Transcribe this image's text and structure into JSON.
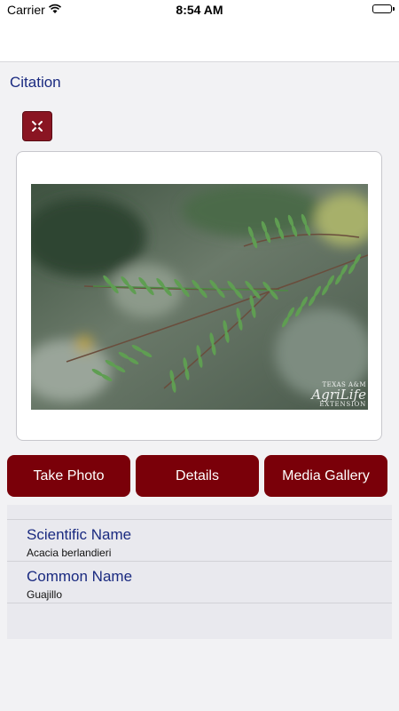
{
  "status_bar": {
    "carrier": "Carrier",
    "time": "8:54 AM",
    "battery_level": 1.0
  },
  "page": {
    "title": "Citation"
  },
  "close_button": {
    "icon": "close-icon"
  },
  "photo": {
    "watermark_line1": "TEXAS A&M",
    "watermark_line2": "AgriLife",
    "watermark_line3": "EXTENSION"
  },
  "actions": {
    "take_photo": "Take Photo",
    "details": "Details",
    "media_gallery": "Media Gallery"
  },
  "fields": [
    {
      "label": "Scientific Name",
      "value": "Acacia berlandieri"
    },
    {
      "label": "Common Name",
      "value": "Guajillo"
    }
  ],
  "colors": {
    "accent": "#7a0009",
    "label_text": "#1a2a80"
  }
}
